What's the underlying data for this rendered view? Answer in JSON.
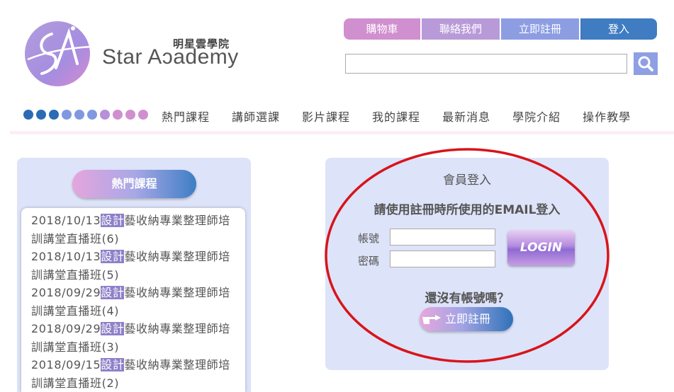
{
  "brand": {
    "cn": "明星雲學院",
    "en": "Star Aɔademy"
  },
  "topnav": {
    "cart": "購物車",
    "contact": "聯絡我們",
    "register": "立即註冊",
    "login": "登入"
  },
  "search": {
    "value": "",
    "icon": "search-icon"
  },
  "dots": [
    "#2b6bb3",
    "#2b6bb3",
    "#2b6bb3",
    "#7f98e0",
    "#7f98e0",
    "#7f98e0",
    "#b690d8",
    "#d08fcf",
    "#d08fcf",
    "#d08fcf"
  ],
  "mainnav": [
    "熱門課程",
    "講師選課",
    "影片課程",
    "我的課程",
    "最新消息",
    "學院介紹",
    "操作教學"
  ],
  "hot": {
    "title": "熱門課程",
    "courses": [
      {
        "date": "2018/10/13",
        "tag": "設計",
        "line1": "藝收納專業整理師培",
        "line2": "訓講堂直播班(6)"
      },
      {
        "date": "2018/10/13",
        "tag": "設計",
        "line1": "藝收納專業整理師培",
        "line2": "訓講堂直播班(5)"
      },
      {
        "date": "2018/09/29",
        "tag": "設計",
        "line1": "藝收納專業整理師培",
        "line2": "訓講堂直播班(4)"
      },
      {
        "date": "2018/09/29",
        "tag": "設計",
        "line1": "藝收納專業整理師培",
        "line2": "訓講堂直播班(3)"
      },
      {
        "date": "2018/09/15",
        "tag": "設計",
        "line1": "藝收納專業整理師培",
        "line2": "訓講堂直播班(2)"
      }
    ]
  },
  "login": {
    "title": "會員登入",
    "subtitle": "請使用註冊時所使用的EMAIL登入",
    "account_label": "帳號",
    "password_label": "密碼",
    "account_value": "",
    "password_value": "",
    "button": "LOGIN",
    "no_account": "還沒有帳號嗎？",
    "register_button": "立即註冊"
  },
  "colors": {
    "accent_blue": "#2b6bb3",
    "accent_pink": "#d08fcf",
    "panel": "#dde3f8",
    "highlight_circle": "#d8141b"
  }
}
